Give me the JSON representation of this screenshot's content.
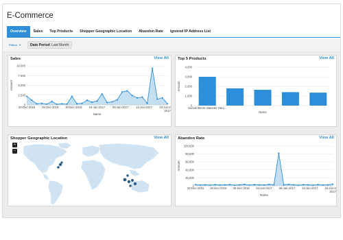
{
  "app": {
    "title": "E-Commerce"
  },
  "tabs": [
    {
      "label": "Overview",
      "active": true
    },
    {
      "label": "Sales",
      "active": false
    },
    {
      "label": "Top Products",
      "active": false
    },
    {
      "label": "Shopper Geographic Location",
      "active": false
    },
    {
      "label": "Abandon Rate",
      "active": false
    },
    {
      "label": "Ignored IP Address List",
      "active": false
    }
  ],
  "filters": {
    "label": "Filters",
    "chip_label": "Date Period",
    "chip_value": "Last Month"
  },
  "colors": {
    "accent": "#2d8fd9",
    "series_fill": "#b7d7ef",
    "bar": "#2d8fd9",
    "map_land": "#cfe3f3",
    "map_point": "#2f5d87"
  },
  "panels": {
    "sales": {
      "title": "Sales",
      "link": "View All"
    },
    "top_products": {
      "title": "Top 5 Products",
      "link": "View All"
    },
    "geo": {
      "title": "Shopper Geographic Location",
      "link": "View All",
      "zoom_in": "+",
      "zoom_out": "−"
    },
    "abandon": {
      "title": "Abandon Rate",
      "link": "View All"
    }
  },
  "chart_data": [
    {
      "id": "sales",
      "type": "area",
      "ylabel": "Amount",
      "xlabel": "Name",
      "ylim": [
        0,
        10000
      ],
      "y_ticks": [
        "0",
        "2,500",
        "5,000",
        "7,500",
        "10,000"
      ],
      "x_ticks": [
        "20-Dec-2016",
        "25-Dec-2016",
        "30-Dec-2016",
        "04-Jan-2017",
        "09-Jan-2017",
        "14-Jan-2017",
        "19-Jan-2017"
      ],
      "x_ticks_line2": [
        "",
        "",
        "",
        "",
        "",
        "",
        "2017"
      ],
      "series": [
        {
          "values": [
            2200,
            1200,
            300,
            400,
            200,
            900,
            150,
            300,
            200,
            2200,
            300,
            400,
            1200,
            700,
            1000,
            2800,
            600,
            800,
            1300,
            3300,
            3600,
            2400,
            1800,
            2000,
            400,
            9400,
            1500,
            1800,
            300
          ]
        }
      ]
    },
    {
      "id": "top_products",
      "type": "bar",
      "ylabel": "Amount",
      "xlabel": "Name",
      "ylim": [
        0,
        4000
      ],
      "y_ticks": [
        "0",
        "1,000",
        "2,000",
        "3,000",
        "4,000"
      ],
      "categories": [
        "Earrall 50mm diameter Hanj...",
        "",
        "",
        "",
        ""
      ],
      "values": [
        3000,
        1800,
        1650,
        1400,
        1350
      ]
    },
    {
      "id": "abandon",
      "type": "area",
      "ylabel": "Amount",
      "xlabel": "Name",
      "ylim": [
        0,
        100000
      ],
      "y_ticks": [
        "0",
        "20,000",
        "40,000",
        "60,000",
        "80,000",
        "100,000"
      ],
      "x_ticks": [
        "20-Dec-2016",
        "25-Dec-2016",
        "30-Dec-2016",
        "04-Jan-2017",
        "09-Jan-2017",
        "14-Jan-2017",
        "19-Jan-2017"
      ],
      "x_ticks_line2": [
        "",
        "",
        "",
        "",
        "",
        "",
        "2017"
      ],
      "series": [
        {
          "values": [
            3000,
            2000,
            2500,
            1500,
            3000,
            2000,
            2500,
            3000,
            1500,
            2500,
            3500,
            2000,
            3000,
            2500,
            2000,
            3500,
            2500,
            82000,
            2500,
            3500,
            2500,
            1500,
            3000,
            2500,
            1500,
            3000,
            2000,
            2500,
            4000
          ]
        }
      ]
    }
  ]
}
